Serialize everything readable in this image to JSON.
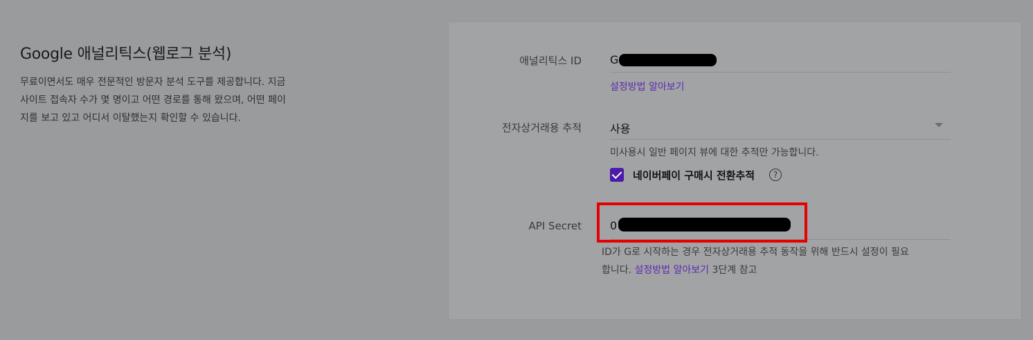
{
  "section": {
    "title": "Google 애널리틱스(웹로그 분석)",
    "desc_line1": "무료이면서도 매우 전문적인 방문자 분석 도구를 제공합니다. 지금",
    "desc_line2": "사이트 접속자 수가 몇 명이고 어떤 경로를 통해 왔으며, 어떤 페이",
    "desc_line3": "지를 보고 있고 어디서 이탈했는지 확인할 수 있습니다."
  },
  "analytics_id": {
    "label": "애널리틱스 ID",
    "value_prefix": "G",
    "help_link": "설정방법 알아보기"
  },
  "ecommerce": {
    "label": "전자상거래용 추적",
    "selected": "사용",
    "hint": "미사용시 일반 페이지 뷰에 대한 추적만 가능합니다.",
    "checkbox_label": "네이버페이 구매시 전환추적",
    "checkbox_checked": true,
    "help_icon": "?"
  },
  "api_secret": {
    "label": "API Secret",
    "value_prefix": "0",
    "hint_line1": "ID가 G로 시작하는 경우 전자상거래용 추적 동작을 위해 반드시 설정이 필요",
    "hint_line2_prefix": "합니다. ",
    "hint_link": "설정방법 알아보기",
    "hint_line2_suffix": " 3단계 참고"
  },
  "colors": {
    "accent": "#4a1aa8",
    "link": "#5b2bb0",
    "highlight": "#e60000"
  }
}
